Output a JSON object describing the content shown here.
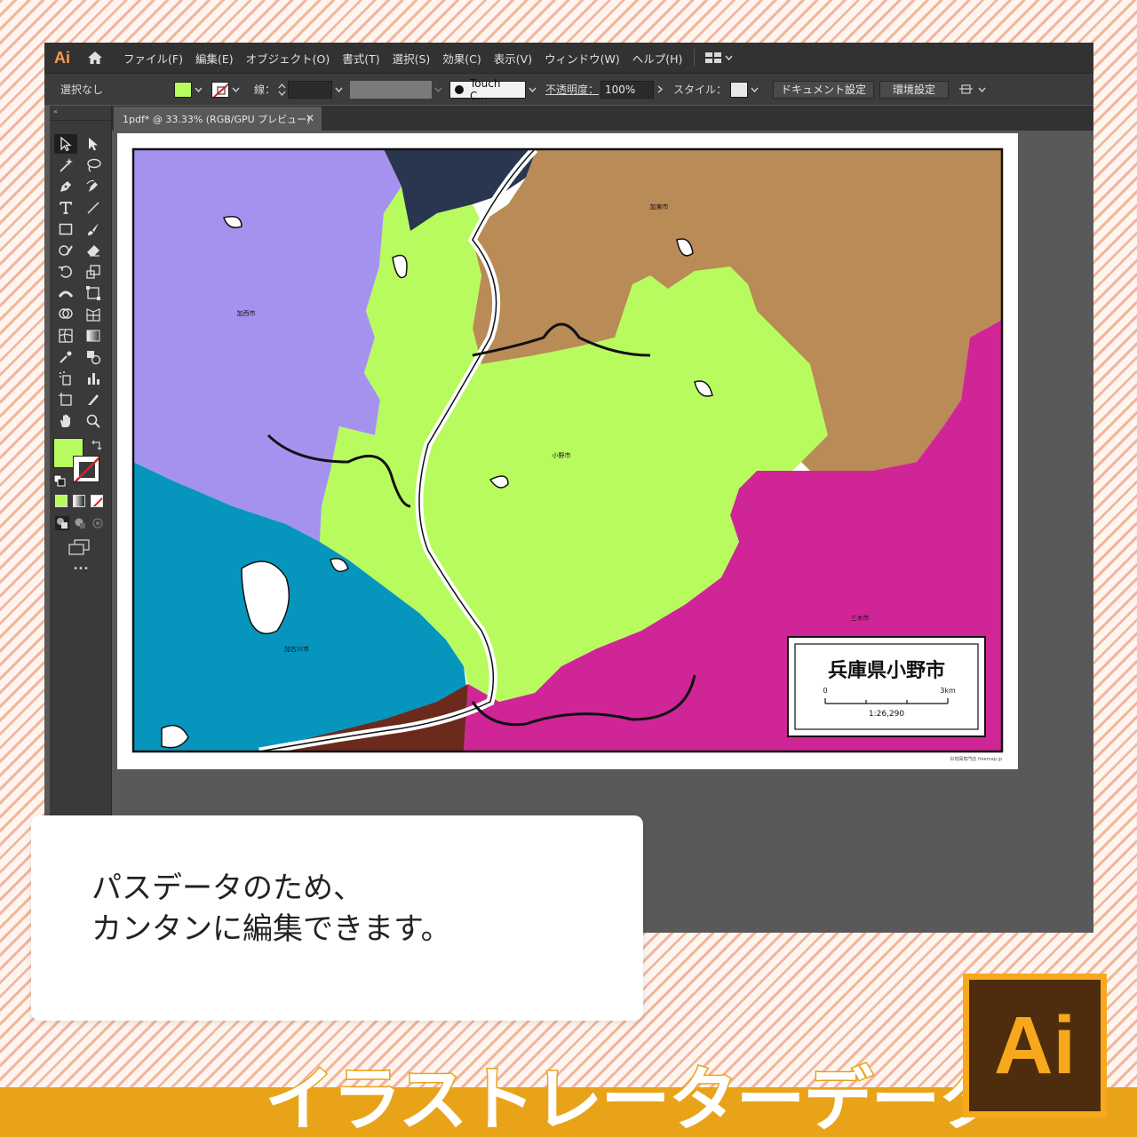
{
  "app": {
    "logo": "Ai",
    "menu": [
      "ファイル(F)",
      "編集(E)",
      "オブジェクト(O)",
      "書式(T)",
      "選択(S)",
      "効果(C)",
      "表示(V)",
      "ウィンドウ(W)",
      "ヘルプ(H)"
    ]
  },
  "control_bar": {
    "selection": "選択なし",
    "fill_color": "#b8fb5e",
    "stroke_label": "線：",
    "brush": "Touch C...",
    "opacity_label": "不透明度：",
    "opacity_value": "100%",
    "style_label": "スタイル：",
    "doc_setup": "ドキュメント設定",
    "prefs": "環境設定"
  },
  "document": {
    "tab_title": "1pdf* @ 33.33% (RGB/GPU プレビュー)"
  },
  "toolbar": {
    "more": "•••"
  },
  "map": {
    "title": "兵庫県小野市",
    "scale_start": "0",
    "scale_end": "3km",
    "scale_ratio": "1:26,290",
    "labels": {
      "ono": "小野市",
      "kato": "加東市",
      "kasai": "加西市",
      "kakogawa": "加古川市",
      "miki": "三木市"
    },
    "credit": "白地図専門店 freemap.jp",
    "colors": {
      "ono": "#b8fb5e",
      "kato": "#b98b56",
      "kasai": "#a592ee",
      "kakogawa": "#0696bd",
      "miki": "#cf2596",
      "north": "#2a3550",
      "south": "#6b2a1c"
    }
  },
  "callout": {
    "line1": "パスデータのため、",
    "line2": "カンタンに編集できます。"
  },
  "banner": {
    "title": "イラストレーターデータ",
    "badge": "Ai"
  }
}
